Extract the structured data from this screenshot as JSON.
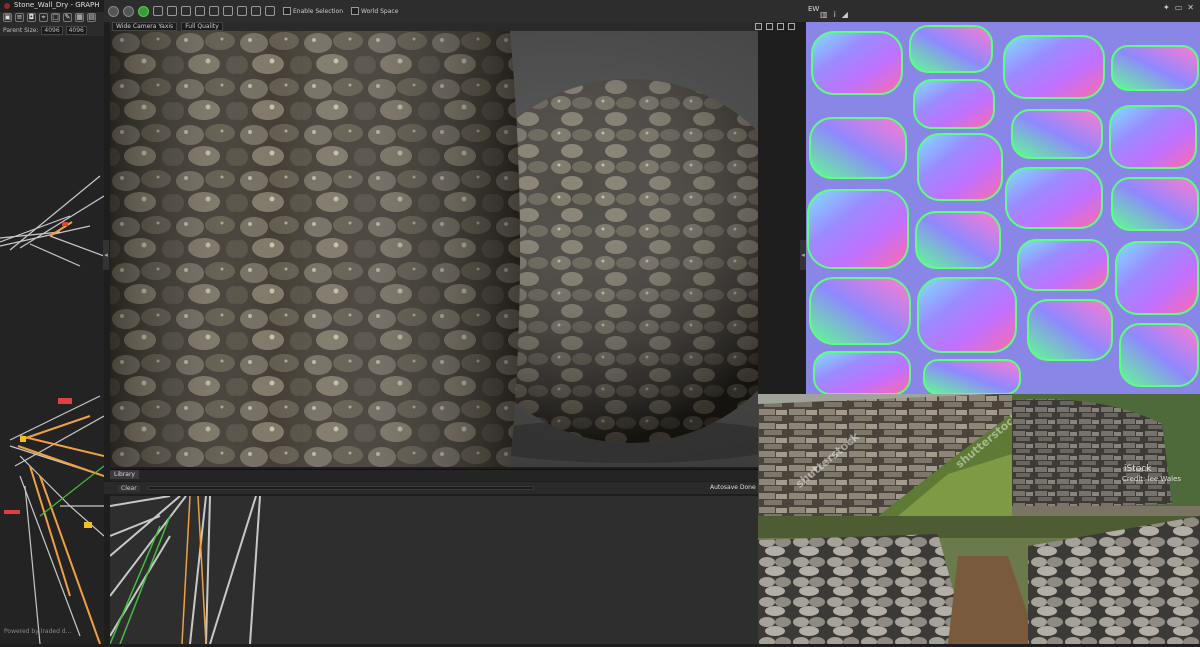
{
  "graph_panel": {
    "title": "Stone_Wall_Dry - GRAPH",
    "param_label": "Parent Size:",
    "param_value_1": "4096",
    "param_value_2": "4096",
    "status_text": "Powered by Iraded d..."
  },
  "viewport": {
    "enable_selection_label": "Enable Selection",
    "world_space_label": "World Space",
    "camera_dropdown": "Wide Camera Yaxis",
    "quality_dropdown": "Full Quality"
  },
  "bottom": {
    "library_tab": "Library",
    "clear_button": "Clear",
    "autosave_text": "Autosave Done"
  },
  "texture_view": {
    "title": "EW"
  },
  "references": {
    "watermark_1": "shutterstock",
    "watermark_2": "shutterstock",
    "istock_label": "iStock",
    "istock_credit": "Credit: lee Wales"
  },
  "colors": {
    "panel_bg": "#262626",
    "toolbar_bg": "#2d2d2d",
    "graph_orange": "#f0a040",
    "graph_green": "#40c040",
    "graph_red": "#e04040"
  }
}
